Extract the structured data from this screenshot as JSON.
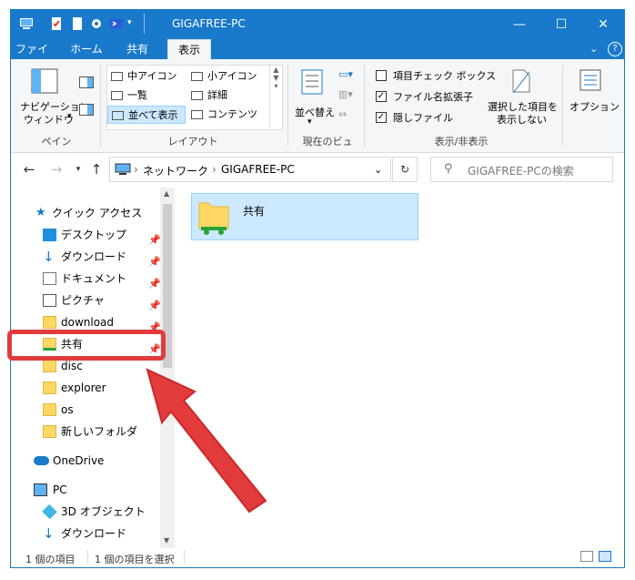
{
  "window": {
    "title": "GIGAFREE-PC"
  },
  "tabs": {
    "file": "ファイル",
    "home": "ホーム",
    "share": "共有",
    "view": "表示"
  },
  "ribbon": {
    "pane": {
      "nav_pane_label1": "ナビゲーション",
      "nav_pane_label2": "ウィンドウ",
      "group": "ペイン"
    },
    "layout": {
      "items": [
        "中アイコン",
        "小アイコン",
        "一覧",
        "詳細",
        "並べて表示",
        "コンテンツ"
      ],
      "group": "レイアウト"
    },
    "current_view": {
      "sort_label": "並べ替え",
      "group": "現在のビュー"
    },
    "show_hide": {
      "item_checkbox": "項目チェック ボックス",
      "file_ext": "ファイル名拡張子",
      "hidden_items": "隠しファイル",
      "hide_selected1": "選択した項目を",
      "hide_selected2": "表示しない",
      "group": "表示/非表示",
      "item_checkbox_checked": false,
      "file_ext_checked": true,
      "hidden_items_checked": true
    },
    "options": "オプション"
  },
  "address": {
    "segments": [
      "ネットワーク",
      "GIGAFREE-PC"
    ]
  },
  "search": {
    "placeholder": "GIGAFREE-PCの検索"
  },
  "sidebar": {
    "quick_access": "クイック アクセス",
    "items": [
      "デスクトップ",
      "ダウンロード",
      "ドキュメント",
      "ピクチャ",
      "download",
      "共有",
      "disc",
      "explorer",
      "os",
      "新しいフォルダ"
    ],
    "onedrive": "OneDrive",
    "pc": "PC",
    "pc_items": [
      "3D オブジェクト",
      "ダウンロード"
    ]
  },
  "content": {
    "files": [
      {
        "name": "共有"
      }
    ]
  },
  "status": {
    "count": "1 個の項目",
    "selected": "1 個の項目を選択"
  },
  "colors": {
    "accent": "#1979ca",
    "selection": "#cce8ff",
    "highlight": "#e23b3b"
  }
}
